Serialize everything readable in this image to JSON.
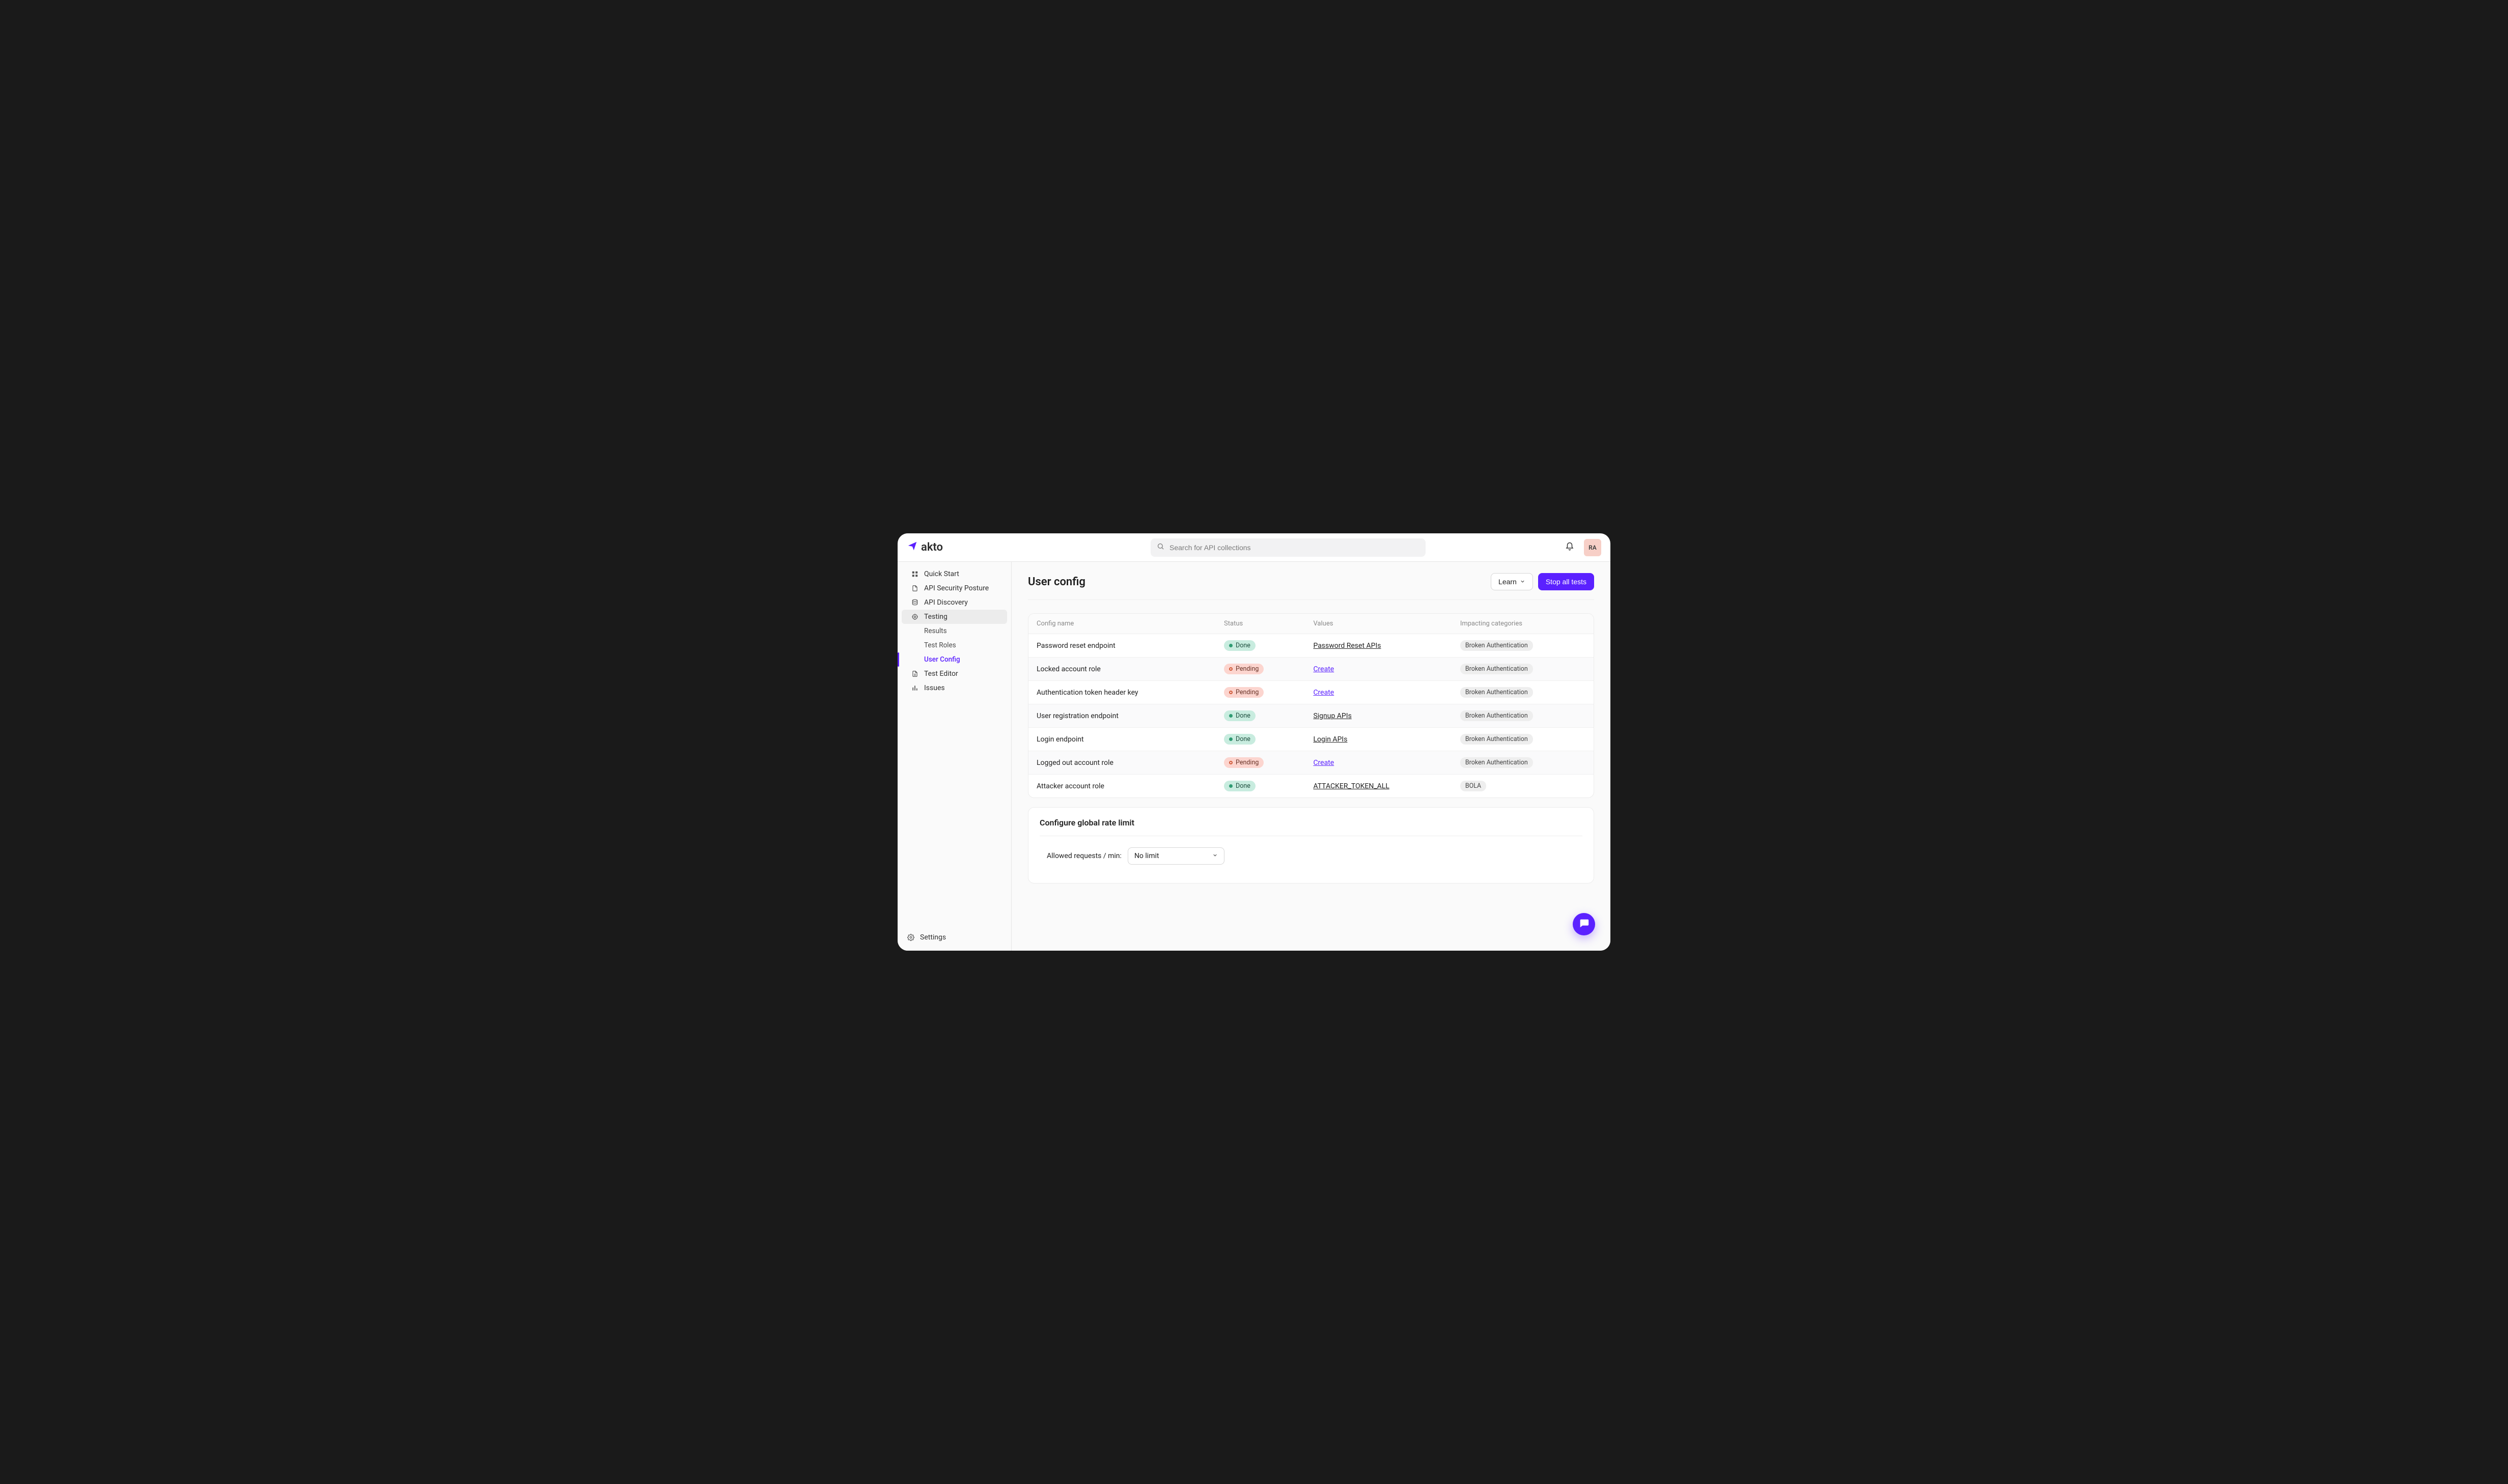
{
  "brand": {
    "name": "akto"
  },
  "search": {
    "placeholder": "Search for API collections"
  },
  "topbar": {
    "avatar_initials": "RA"
  },
  "sidebar": {
    "items": [
      {
        "label": "Quick Start"
      },
      {
        "label": "API Security Posture"
      },
      {
        "label": "API Discovery"
      },
      {
        "label": "Testing"
      }
    ],
    "testing_sub": [
      {
        "label": "Results"
      },
      {
        "label": "Test Roles"
      },
      {
        "label": "User Config"
      }
    ],
    "items2": [
      {
        "label": "Test Editor"
      },
      {
        "label": "Issues"
      }
    ],
    "settings_label": "Settings"
  },
  "page": {
    "title": "User config",
    "learn_label": "Learn",
    "stop_label": "Stop all tests"
  },
  "table": {
    "headers": {
      "config": "Config name",
      "status": "Status",
      "values": "Values",
      "impact": "Impacting categories"
    },
    "status_labels": {
      "done": "Done",
      "pending": "Pending"
    },
    "create_label": "Create",
    "rows": [
      {
        "name": "Password reset endpoint",
        "status": "done",
        "value": "Password Reset APIs",
        "value_kind": "link",
        "impact": "Broken Authentication"
      },
      {
        "name": "Locked account role",
        "status": "pending",
        "value_kind": "create",
        "impact": "Broken Authentication"
      },
      {
        "name": "Authentication token header key",
        "status": "pending",
        "value_kind": "create",
        "impact": "Broken Authentication"
      },
      {
        "name": "User registration endpoint",
        "status": "done",
        "value": "Signup APIs",
        "value_kind": "link",
        "impact": "Broken Authentication"
      },
      {
        "name": "Login endpoint",
        "status": "done",
        "value": "Login APIs",
        "value_kind": "link",
        "impact": "Broken Authentication"
      },
      {
        "name": "Logged out account role",
        "status": "pending",
        "value_kind": "create",
        "impact": "Broken Authentication"
      },
      {
        "name": "Attacker account role",
        "status": "done",
        "value": "ATTACKER_TOKEN_ALL",
        "value_kind": "link",
        "impact": "BOLA"
      }
    ]
  },
  "rate_limit": {
    "title": "Configure global rate limit",
    "label": "Allowed requests / min:",
    "selected": "No limit"
  }
}
